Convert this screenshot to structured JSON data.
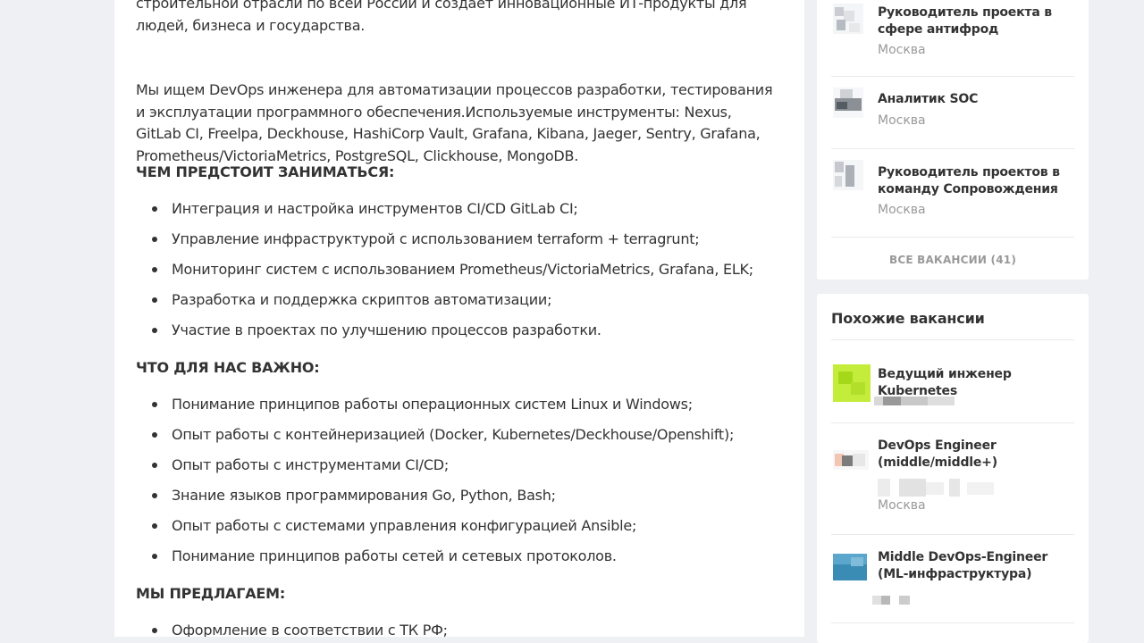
{
  "description": {
    "paragraphs": [
      "строительной отрасли по всей России и создает инновационные ИТ-продукты для людей, бизнеса и государства.",
      "Мы ищем DevOps инженера для автоматизации процессов разработки, тестирования и эксплуатации программного обеспечения.Используемые инструменты: Nexus, GitLab CI, Freelpa, Deckhouse, HashiCorp Vault, Grafana, Kibana, Jaeger, Sentry, Grafana, Prometheus/VictoriaMetrics, PostgreSQL, Clickhouse, MongoDB."
    ],
    "sections": [
      {
        "heading": "ЧЕМ ПРЕДСТОИТ ЗАНИМАТЬСЯ:",
        "items": [
          "Интеграция и настройка инструментов CI/CD GitLab CI;",
          "Управление инфраструктурой с использованием terraform + terragrunt;",
          "Мониторинг систем с использованием Prometheus/VictoriaMetrics, Grafana, ELK;",
          "Разработка и поддержка скриптов автоматизации;",
          "Участие в проектах по улучшению процессов разработки."
        ]
      },
      {
        "heading": "ЧТО ДЛЯ НАС ВАЖНО:",
        "items": [
          "Понимание принципов работы операционных систем Linux и Windows;",
          "Опыт работы с контейнеризацией (Docker, Kubernetes/Deckhouse/Openshift);",
          "Опыт работы с инструментами CI/CD;",
          "Знание языков программирования Go, Python, Bash;",
          "Опыт работы с системами управления конфигурацией Ansible;",
          "Понимание принципов работы сетей и сетевых протоколов."
        ]
      },
      {
        "heading": "МЫ ПРЕДЛАГАЕМ:",
        "items": [
          "Оформление в соответствии с ТК РФ;"
        ]
      }
    ]
  },
  "company_vacancies": {
    "items": [
      {
        "title": "Руководитель проекта в сфере антифрод",
        "city": "Москва"
      },
      {
        "title": "Аналитик SOC",
        "city": "Москва"
      },
      {
        "title": "Руководитель проектов в команду Сопровождения",
        "city": "Москва"
      }
    ],
    "all_label": "ВСЕ ВАКАНСИИ (41)"
  },
  "similar_vacancies": {
    "title": "Похожие вакансии",
    "items": [
      {
        "title": "Ведущий инженер Kubernetes",
        "city": ""
      },
      {
        "title": "DevOps Engineer (middle/middle+)",
        "city": "Москва"
      },
      {
        "title": "Middle DevOps-Engineer (ML-инфраструктура)",
        "city": ""
      }
    ]
  },
  "colors": {
    "page_bg": "#eef0f3",
    "card_bg": "#ffffff",
    "text": "#333333",
    "muted": "#999999"
  }
}
